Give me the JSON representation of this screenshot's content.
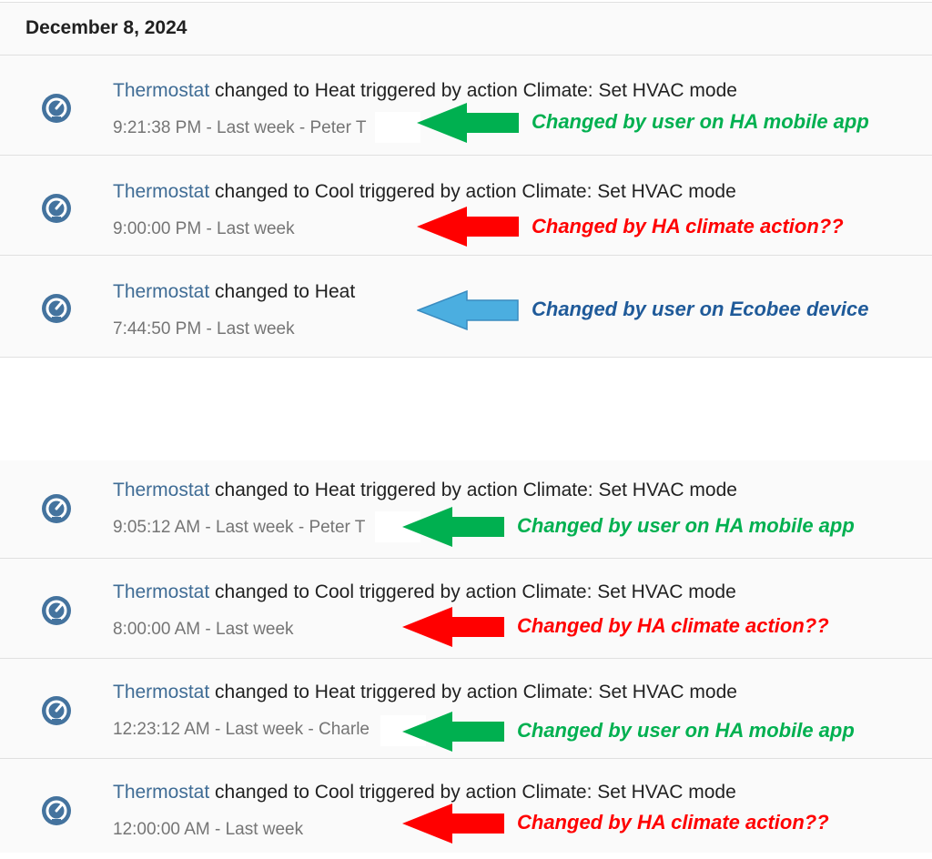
{
  "colors": {
    "entity": "#3f6c95",
    "icon": "#44739e",
    "green": "#00b050",
    "red": "#ff0000",
    "blue": "#4baee0",
    "blue_text": "#1f5a99"
  },
  "date_header": "December 8, 2024",
  "top_entries": [
    {
      "entity": "Thermostat",
      "message": " changed to Heat triggered by action Climate: Set HVAC mode",
      "time": "9:21:38 PM - Last week - Peter T",
      "icon": "thermostat-icon",
      "note": "Changed by user on HA mobile app",
      "note_color": "green"
    },
    {
      "entity": "Thermostat",
      "message": " changed to Cool triggered by action Climate: Set HVAC mode",
      "time": "9:00:00 PM - Last week",
      "icon": "thermostat-icon",
      "note": "Changed by HA climate action??",
      "note_color": "red"
    },
    {
      "entity": "Thermostat",
      "message": " changed to Heat",
      "time": "7:44:50 PM - Last week",
      "icon": "thermostat-icon",
      "note": "Changed by user on Ecobee device",
      "note_color": "blue"
    }
  ],
  "bottom_entries": [
    {
      "entity": "Thermostat",
      "message": " changed to Heat triggered by action Climate: Set HVAC mode",
      "time": "9:05:12 AM - Last week - Peter T",
      "icon": "thermostat-icon",
      "note": "Changed by user on HA mobile app",
      "note_color": "green"
    },
    {
      "entity": "Thermostat",
      "message": " changed to Cool triggered by action Climate: Set HVAC mode",
      "time": "8:00:00 AM - Last week",
      "icon": "thermostat-icon",
      "note": "Changed by HA climate action??",
      "note_color": "red"
    },
    {
      "entity": "Thermostat",
      "message": " changed to Heat triggered by action Climate: Set HVAC mode",
      "time": "12:23:12 AM - Last week - Charle",
      "icon": "thermostat-icon",
      "note": "Changed by user on HA mobile app",
      "note_color": "green"
    },
    {
      "entity": "Thermostat",
      "message": " changed to Cool triggered by action Climate: Set HVAC mode",
      "time": "12:00:00 AM - Last week",
      "icon": "thermostat-icon",
      "note": "Changed by HA climate action??",
      "note_color": "red"
    }
  ]
}
